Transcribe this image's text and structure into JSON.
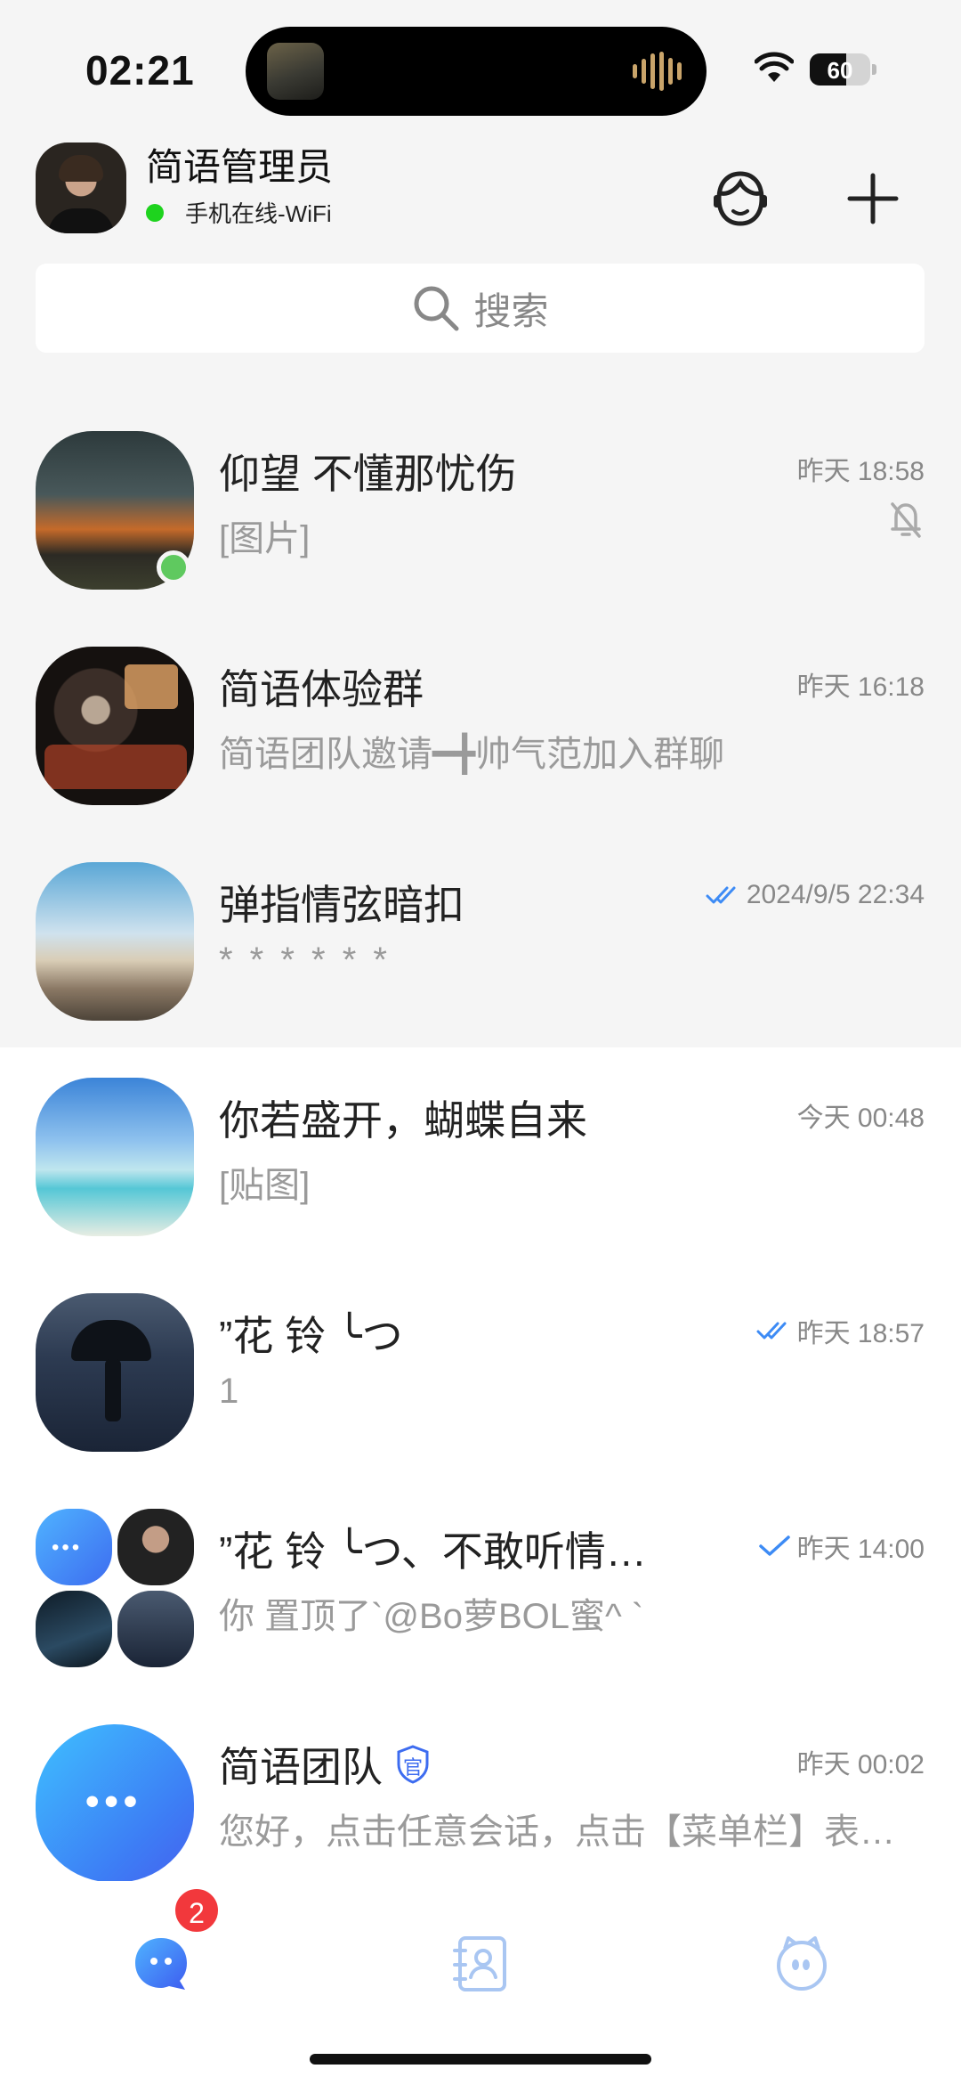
{
  "status_bar": {
    "time": "02:21",
    "battery": "60",
    "battery_level": 0.6
  },
  "profile": {
    "name": "简语管理员",
    "status": "手机在线-WiFi"
  },
  "search": {
    "placeholder": "搜索"
  },
  "chats": [
    {
      "title": "仰望 不懂那忧伤",
      "preview": "[图片]",
      "time": "昨天 18:58",
      "muted": true,
      "online": true
    },
    {
      "title": "简语体验群",
      "preview": "简语团队邀请━╋帅气范加入群聊",
      "time": "昨天 16:18"
    },
    {
      "title": "弹指情弦暗扣",
      "preview": "* * * * * *",
      "time": "2024/9/5 22:34",
      "read": true
    },
    {
      "title": "你若盛开，蝴蝶自来",
      "preview": "[贴图]",
      "time": "今天 00:48"
    },
    {
      "title": "”花 铃 ╰つ",
      "preview": "1",
      "time": "昨天 18:57",
      "read": true
    },
    {
      "title": "”花 铃 ╰つ、不敢听情…",
      "preview": "你 置顶了`@Bo萝BOL蜜^ `",
      "time": "昨天 14:00",
      "sent": true
    },
    {
      "title": "简语团队",
      "badge_icon": "官",
      "preview": "您好，点击任意会话，点击【菜单栏】表…",
      "time": "昨天 00:02"
    }
  ],
  "tabbar": {
    "unread": "2",
    "icons": [
      "chat-icon",
      "contacts-icon",
      "discover-icon"
    ]
  },
  "colors": {
    "accent": "#3d8bf5",
    "online": "#1ed31e",
    "badge": "#f2383c"
  }
}
